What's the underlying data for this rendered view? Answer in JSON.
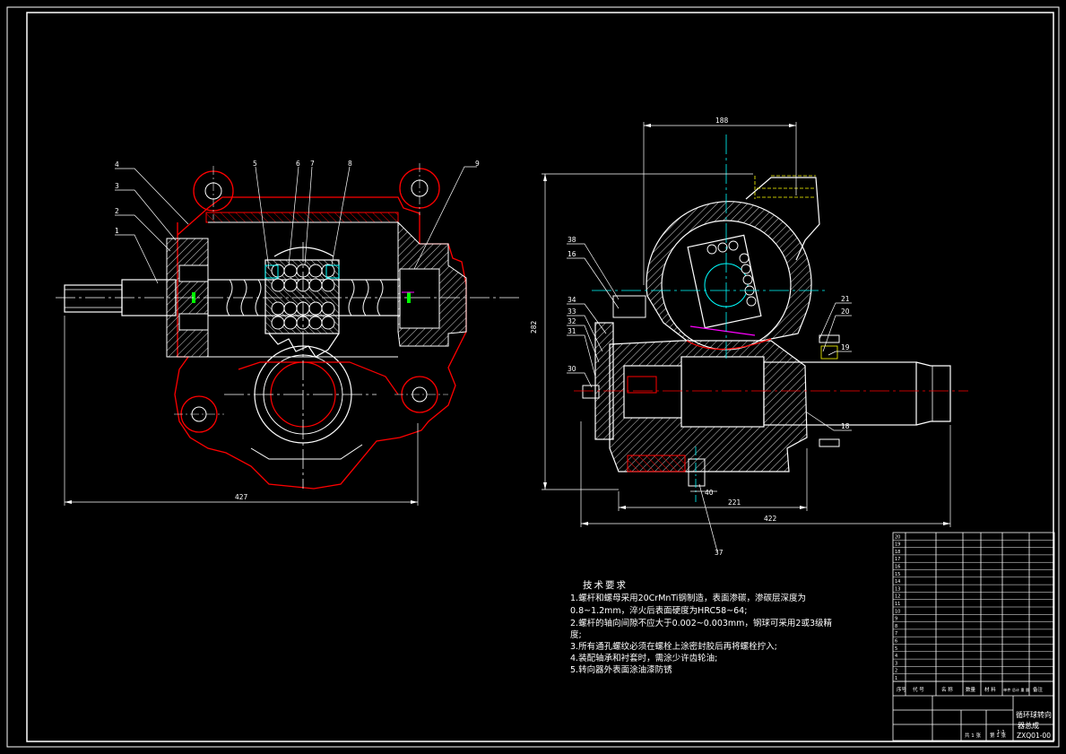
{
  "colors": {
    "background": "#000000",
    "outline": "#ffffff",
    "housing": "#ff0000",
    "centerline": "#00ffff",
    "dimension": "#ffffff",
    "hatch": "#ffffff",
    "accent_green": "#00ff00",
    "accent_magenta": "#ff00ff",
    "accent_yellow": "#ffff00"
  },
  "left_view": {
    "balloons": [
      "4",
      "3",
      "2",
      "1",
      "5",
      "6",
      "7",
      "8",
      "9"
    ],
    "dimension_overall": "427"
  },
  "right_view": {
    "balloons_left": [
      "38",
      "16",
      "34",
      "33",
      "32",
      "31",
      "30"
    ],
    "balloons_right": [
      "21",
      "20",
      "19",
      "18"
    ],
    "balloon_bottom": "37",
    "dimension_top": "188",
    "dimension_height": "282",
    "dimension_mid": "221",
    "dimension_overall": "422",
    "dimension_small": "40"
  },
  "tech_requirements": {
    "title": "技术要求",
    "lines": [
      "1.螺杆和螺母采用20CrMnTi钢制造，表面渗碳，渗碳层深度为",
      "0.8~1.2mm，淬火后表面硬度为HRC58~64;",
      "2.螺杆的轴向间隙不应大于0.002~0.003mm，钢球可采用2或3级精",
      "度;",
      "3.所有通孔螺纹必须在螺栓上涂密封胶后再将螺栓拧入;",
      "4.装配轴承和衬套时，需涂少许齿轮油;",
      "5.转向器外表面涂油漆防锈"
    ]
  },
  "title_block": {
    "title_line1": "循环球转向",
    "title_line2": "器总成",
    "drawing_no": "ZXQ01-00",
    "scale": "1:1",
    "sheet": "第 1 张",
    "sheets_total": "共 1 张",
    "header_no": "序号",
    "header_code": "代 号",
    "header_name": "名 称",
    "header_qty": "数量",
    "header_material": "材 料",
    "header_weight": "单件 总计 重 量",
    "header_remark": "备注",
    "row_numbers": [
      "20",
      "19",
      "18",
      "17",
      "16",
      "15",
      "14",
      "13",
      "12",
      "11",
      "10",
      "9",
      "8",
      "7",
      "6",
      "5",
      "4",
      "3",
      "2",
      "1"
    ]
  }
}
